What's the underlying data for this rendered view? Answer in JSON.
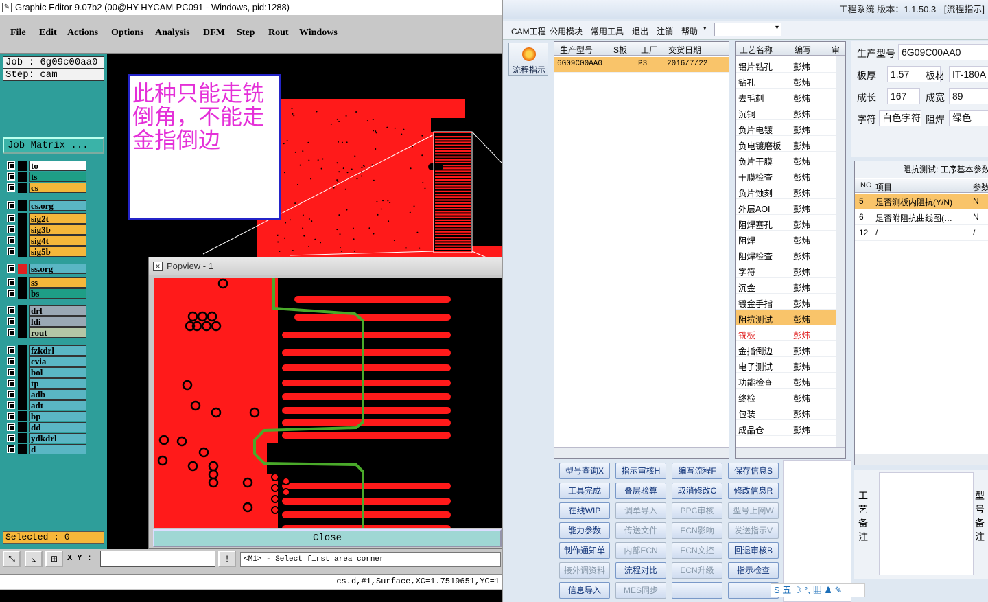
{
  "ge": {
    "title": "Graphic Editor 9.07b2 (00@HY-HYCAM-PC091 - Windows, pid:1288)",
    "menu": [
      "File",
      "Edit",
      "Actions",
      "Options",
      "Analysis",
      "DFM",
      "Step",
      "Rout",
      "Windows"
    ],
    "job": "Job : 6g09c00aa0",
    "step": "Step: cam",
    "job_matrix": "Job Matrix ...",
    "layers": [
      {
        "name": "to",
        "color": "#ffffff",
        "swatch": "#000000"
      },
      {
        "name": "ts",
        "color": "#1e9e86",
        "swatch": "#000000"
      },
      {
        "name": "cs",
        "color": "#f5b73a",
        "swatch": "#000000"
      },
      {
        "name": "cs.org",
        "color": "#5ab6c4",
        "swatch": "#000000"
      },
      {
        "name": "sig2t",
        "color": "#f5b73a",
        "swatch": "#000000"
      },
      {
        "name": "sig3b",
        "color": "#f5b73a",
        "swatch": "#000000"
      },
      {
        "name": "sig4t",
        "color": "#f5b73a",
        "swatch": "#000000"
      },
      {
        "name": "sig5b",
        "color": "#f5b73a",
        "swatch": "#000000"
      },
      {
        "name": "ss.org",
        "color": "#5ab6c4",
        "swatch": "#e02020"
      },
      {
        "name": "ss",
        "color": "#f5b73a",
        "swatch": "#000000"
      },
      {
        "name": "bs",
        "color": "#1e9e86",
        "swatch": "#000000"
      },
      {
        "name": "drl",
        "color": "#9aa8b4",
        "swatch": "#000000"
      },
      {
        "name": "ldi",
        "color": "#9aa8b4",
        "swatch": "#000000"
      },
      {
        "name": "rout",
        "color": "#b4c6a6",
        "swatch": "#000000"
      },
      {
        "name": "fzkdrl",
        "color": "#5ab6c4",
        "swatch": "#000000"
      },
      {
        "name": "cvia",
        "color": "#5ab6c4",
        "swatch": "#000000"
      },
      {
        "name": "bol",
        "color": "#5ab6c4",
        "swatch": "#000000"
      },
      {
        "name": "tp",
        "color": "#5ab6c4",
        "swatch": "#000000"
      },
      {
        "name": "adb",
        "color": "#5ab6c4",
        "swatch": "#000000"
      },
      {
        "name": "adt",
        "color": "#5ab6c4",
        "swatch": "#000000"
      },
      {
        "name": "bp",
        "color": "#5ab6c4",
        "swatch": "#000000"
      },
      {
        "name": "dd",
        "color": "#5ab6c4",
        "swatch": "#000000"
      },
      {
        "name": "ydkdrl",
        "color": "#5ab6c4",
        "swatch": "#000000"
      },
      {
        "name": "d",
        "color": "#5ab6c4",
        "swatch": "#000000"
      }
    ],
    "selected": "Selected : 0",
    "xy_label": "X Y :",
    "message": "<M1> - Select first area corner",
    "status": "cs.d,#1,Surface,XC=1.7519651,YC=1",
    "note": "此种只能走铣倒角，不能走金指倒边",
    "popview_title": "Popview - 1",
    "popview_close": "Close"
  },
  "cam": {
    "title": "工程系统   版本：1.1.50.3 - [流程指示]",
    "menu": [
      "CAM工程",
      "公用模块",
      "常用工具",
      "退出",
      "注销",
      "帮助"
    ],
    "flow_button": "流程指示",
    "product_grid": {
      "headers": [
        "生产型号",
        "S板",
        "工厂",
        "交货日期"
      ],
      "rows": [
        [
          "6G09C00AA0",
          "",
          "P3",
          "2016/7/22"
        ]
      ]
    },
    "process_grid": {
      "headers": [
        "工艺名称",
        "编写",
        "审"
      ],
      "rows": [
        {
          "name": "铝片钻孔",
          "author": "彭炜",
          "state": "normal"
        },
        {
          "name": "钻孔",
          "author": "彭炜",
          "state": "normal"
        },
        {
          "name": "去毛刺",
          "author": "彭炜",
          "state": "normal"
        },
        {
          "name": "沉铜",
          "author": "彭炜",
          "state": "normal"
        },
        {
          "name": "负片电镀",
          "author": "彭炜",
          "state": "normal"
        },
        {
          "name": "负电镀磨板",
          "author": "彭炜",
          "state": "normal"
        },
        {
          "name": "负片干膜",
          "author": "彭炜",
          "state": "normal"
        },
        {
          "name": "干膜检查",
          "author": "彭炜",
          "state": "normal"
        },
        {
          "name": "负片蚀刻",
          "author": "彭炜",
          "state": "normal"
        },
        {
          "name": "外层AOI",
          "author": "彭炜",
          "state": "normal"
        },
        {
          "name": "阻焊塞孔",
          "author": "彭炜",
          "state": "normal"
        },
        {
          "name": "阻焊",
          "author": "彭炜",
          "state": "normal"
        },
        {
          "name": "阻焊检查",
          "author": "彭炜",
          "state": "normal"
        },
        {
          "name": "字符",
          "author": "彭炜",
          "state": "normal"
        },
        {
          "name": "沉金",
          "author": "彭炜",
          "state": "normal"
        },
        {
          "name": "镀金手指",
          "author": "彭炜",
          "state": "normal"
        },
        {
          "name": "阻抗测试",
          "author": "彭炜",
          "state": "selected"
        },
        {
          "name": "铣板",
          "author": "彭炜",
          "state": "red"
        },
        {
          "name": "金指倒边",
          "author": "彭炜",
          "state": "normal"
        },
        {
          "name": "电子测试",
          "author": "彭炜",
          "state": "normal"
        },
        {
          "name": "功能检查",
          "author": "彭炜",
          "state": "normal"
        },
        {
          "name": "终检",
          "author": "彭炜",
          "state": "normal"
        },
        {
          "name": "包装",
          "author": "彭炜",
          "state": "normal"
        },
        {
          "name": "成品仓",
          "author": "彭炜",
          "state": "normal"
        }
      ]
    },
    "info": {
      "product_label": "生产型号",
      "product_value": "6G09C00AA0",
      "thickness_label": "板厚",
      "thickness_value": "1.57",
      "material_label": "板材",
      "material_value": "IT-180A",
      "length_label": "成长",
      "length_value": "167",
      "width_label": "成宽",
      "width_value": "89",
      "char_label": "字符",
      "char_value": "白色字符",
      "mask_label": "阻焊",
      "mask_value": "绿色"
    },
    "impedance": {
      "title": "阻抗测试: 工序基本参数",
      "headers": [
        "NO",
        "项目",
        "参数"
      ],
      "rows": [
        [
          "5",
          "是否测板内阻抗(Y/N)",
          "N"
        ],
        [
          "6",
          "是否附阻抗曲线图(…",
          "N"
        ],
        [
          "12",
          "/",
          "/"
        ]
      ]
    },
    "buttons": [
      {
        "label": "型号查询X",
        "disabled": false
      },
      {
        "label": "指示审核H",
        "disabled": false
      },
      {
        "label": "编写流程F",
        "disabled": false
      },
      {
        "label": "保存信息S",
        "disabled": false
      },
      {
        "label": "工具完成",
        "disabled": false
      },
      {
        "label": "叠层验算",
        "disabled": false
      },
      {
        "label": "取消修改C",
        "disabled": false
      },
      {
        "label": "修改信息R",
        "disabled": false
      },
      {
        "label": "在线WIP",
        "disabled": false
      },
      {
        "label": "调单导入",
        "disabled": true
      },
      {
        "label": "PPC审核",
        "disabled": true
      },
      {
        "label": "型号上网W",
        "disabled": true
      },
      {
        "label": "能力参数",
        "disabled": false
      },
      {
        "label": "传送文件",
        "disabled": true
      },
      {
        "label": "ECN影响",
        "disabled": true
      },
      {
        "label": "发送指示V",
        "disabled": true
      },
      {
        "label": "制作通知单",
        "disabled": false
      },
      {
        "label": "内部ECN",
        "disabled": true
      },
      {
        "label": "ECN文控",
        "disabled": true
      },
      {
        "label": "回退审核B",
        "disabled": false
      },
      {
        "label": "接外调资料",
        "disabled": true
      },
      {
        "label": "流程对比",
        "disabled": false
      },
      {
        "label": "ECN升级",
        "disabled": true
      },
      {
        "label": "指示检查",
        "disabled": false
      },
      {
        "label": "信息导入",
        "disabled": false
      },
      {
        "label": "MES同步",
        "disabled": true
      },
      {
        "label": "",
        "disabled": false
      },
      {
        "label": "",
        "disabled": false
      }
    ],
    "remark_left": "工艺备注",
    "remark_right": "型号备注",
    "ime": "S 五 ☽ °, ▦ ♟ ✎"
  },
  "colors": {
    "pcb_red": "#ff1a1a",
    "trace_green": "#4aaa2a",
    "teal": "#2e9e9a",
    "orange": "#f5b73a",
    "note_magenta": "#e430d8"
  }
}
